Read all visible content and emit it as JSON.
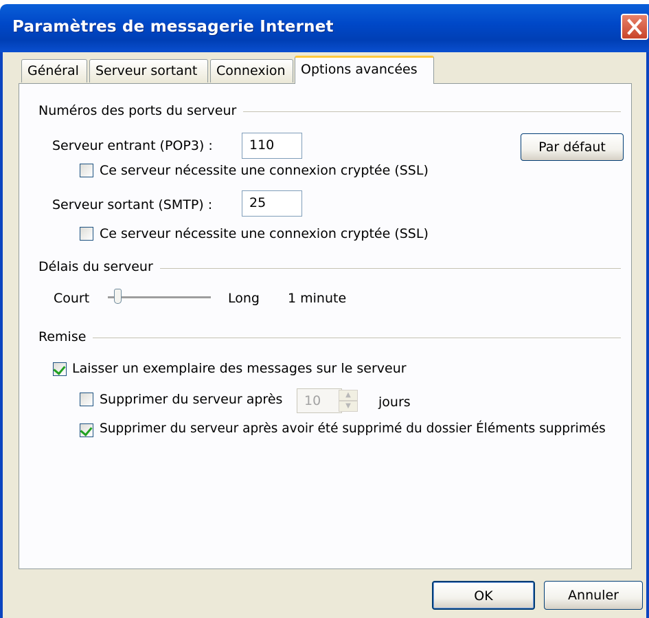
{
  "window": {
    "title": "Paramètres de messagerie Internet",
    "close_icon": "close-icon",
    "accent_color": "#0048c8"
  },
  "tabs": [
    {
      "label": "Général",
      "active": false
    },
    {
      "label": "Serveur sortant",
      "active": false
    },
    {
      "label": "Connexion",
      "active": false
    },
    {
      "label": "Options avancées",
      "active": true
    }
  ],
  "ports": {
    "group_title": "Numéros des ports du serveur",
    "incoming_label": "Serveur entrant (POP3) :",
    "incoming_value": "110",
    "incoming_ssl_label": "Ce serveur nécessite une connexion cryptée (SSL)",
    "incoming_ssl_checked": false,
    "outgoing_label": "Serveur sortant (SMTP) :",
    "outgoing_value": "25",
    "outgoing_ssl_label": "Ce serveur nécessite une connexion cryptée (SSL)",
    "outgoing_ssl_checked": false,
    "default_button": "Par défaut"
  },
  "timeouts": {
    "group_title": "Délais du serveur",
    "short_label": "Court",
    "long_label": "Long",
    "value_label": "1 minute",
    "slider_level": 0.1
  },
  "delivery": {
    "group_title": "Remise",
    "leave_copy_label": "Laisser un exemplaire des messages sur le serveur",
    "leave_copy_checked": true,
    "remove_after_label": "Supprimer du serveur après",
    "remove_after_checked": false,
    "remove_after_days": "10",
    "days_label": "jours",
    "remove_when_deleted_label": "Supprimer du serveur après avoir été supprimé du dossier Éléments supprimés",
    "remove_when_deleted_checked": true
  },
  "footer": {
    "ok_label": "OK",
    "cancel_label": "Annuler"
  }
}
